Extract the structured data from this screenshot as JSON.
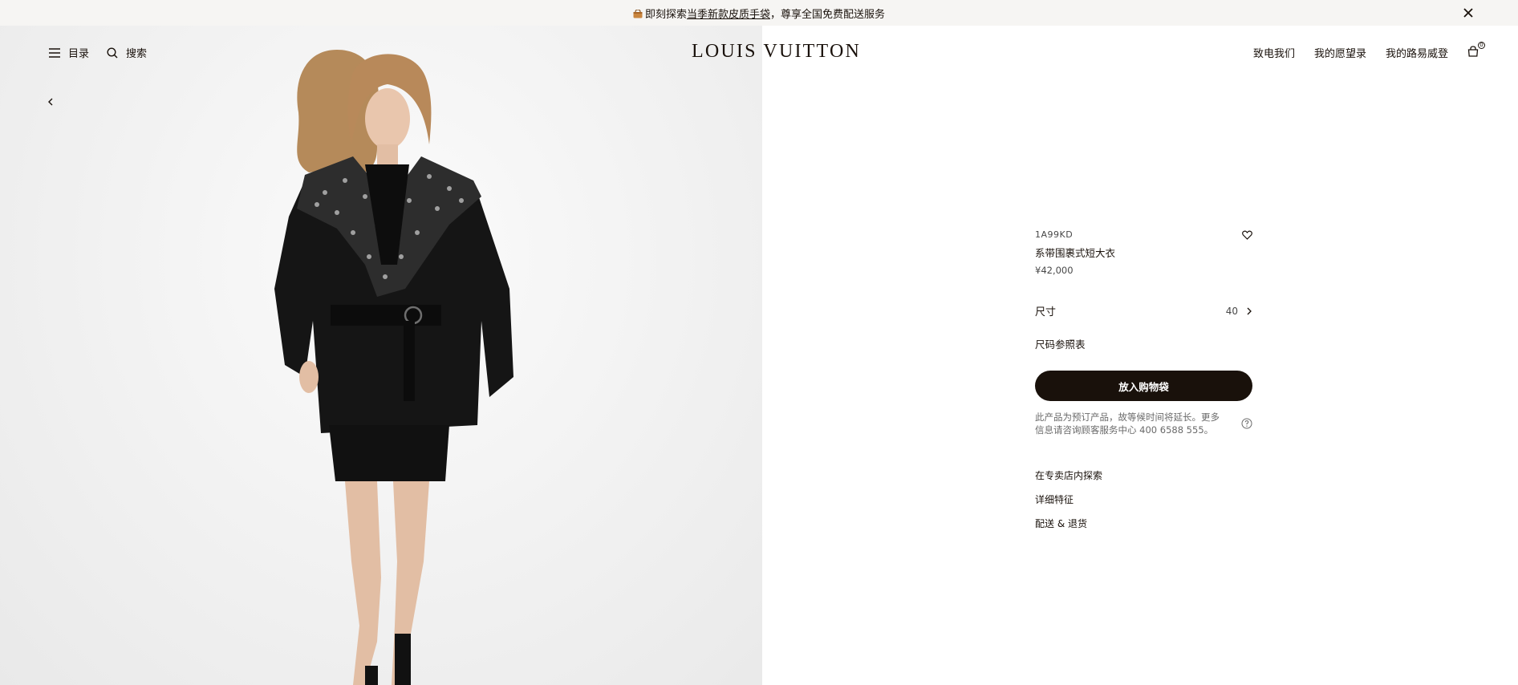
{
  "announcement": {
    "prefix": "即刻探索",
    "link_text": "当季新款皮质手袋",
    "suffix": "，尊享全国免费配送服务"
  },
  "header": {
    "menu_label": "目录",
    "search_label": "搜索",
    "logo_text": "LOUIS VUITTON",
    "contact_label": "致电我们",
    "wishlist_label": "我的愿望录",
    "account_label": "我的路易威登",
    "bag_count": "0"
  },
  "product": {
    "sku": "1A99KD",
    "name": "系带围裹式短大衣",
    "price": "¥42,000",
    "size_label": "尺寸",
    "size_value": "40",
    "size_guide": "尺码参照表",
    "add_to_bag": "放入购物袋",
    "note": "此产品为预订产品，故等候时间将延长。更多信息请咨询顾客服务中心 400 6588 555。",
    "links": [
      "在专卖店内探索",
      "详细特征",
      "配送 & 退货"
    ]
  },
  "colors": {
    "brand_dark": "#19110b",
    "announce_bg": "#f6f5f3"
  },
  "icons": [
    "bag-emoji-icon",
    "close-icon",
    "menu-icon",
    "search-icon",
    "back-arrow-icon",
    "shopping-bag-icon",
    "heart-icon",
    "chevron-right-icon",
    "help-icon"
  ]
}
